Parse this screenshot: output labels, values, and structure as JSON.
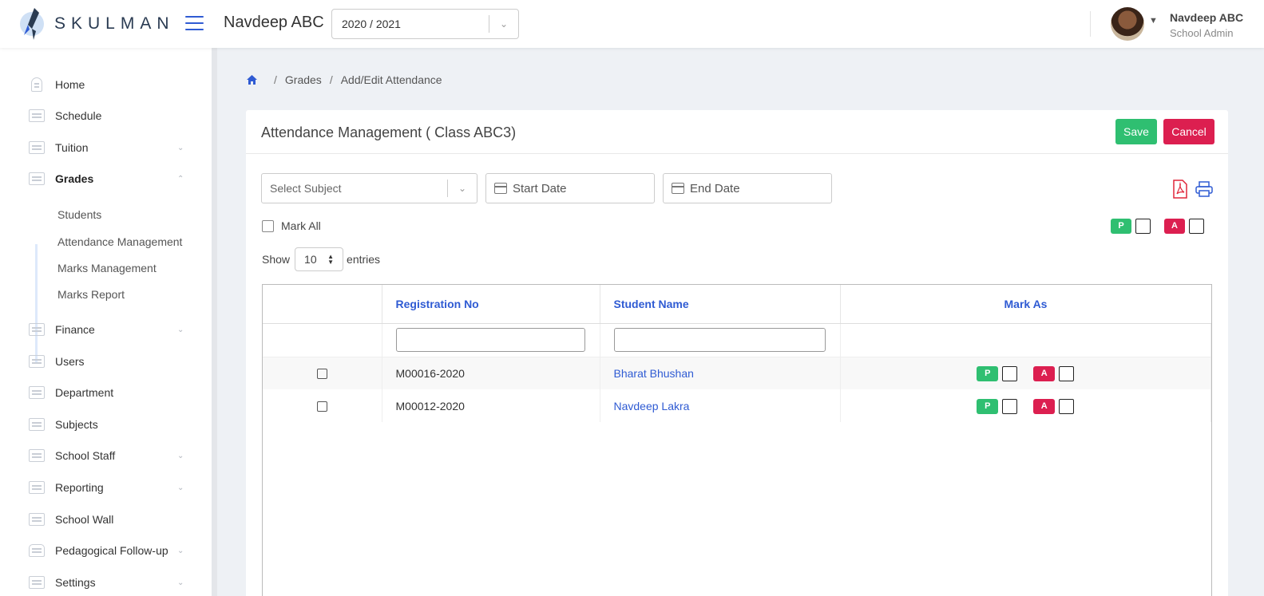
{
  "header": {
    "logo_text": "SKULMAN",
    "school_name": "Navdeep ABC",
    "year_select": {
      "value": "2020 / 2021"
    },
    "user": {
      "name": "Navdeep ABC",
      "role": "School Admin"
    }
  },
  "sidebar": {
    "items": [
      {
        "label": "Home"
      },
      {
        "label": "Schedule"
      },
      {
        "label": "Tuition"
      },
      {
        "label": "Grades"
      },
      {
        "label": "Finance"
      },
      {
        "label": "Users"
      },
      {
        "label": "Department"
      },
      {
        "label": "Subjects"
      },
      {
        "label": "School Staff"
      },
      {
        "label": "Reporting"
      },
      {
        "label": "School Wall"
      },
      {
        "label": "Pedagogical Follow-up"
      },
      {
        "label": "Settings"
      }
    ],
    "grades_sub": [
      {
        "label": "Students"
      },
      {
        "label": "Attendance Management"
      },
      {
        "label": "Marks Management"
      },
      {
        "label": "Marks Report"
      }
    ]
  },
  "breadcrumb": {
    "items": [
      "Grades",
      "Add/Edit Attendance"
    ]
  },
  "card": {
    "title": "Attendance Management ( Class ABC3)",
    "save_label": "Save",
    "cancel_label": "Cancel"
  },
  "filters": {
    "subject_placeholder": "Select Subject",
    "start_placeholder": "Start Date",
    "end_placeholder": "End Date"
  },
  "mark_all_label": "Mark All",
  "legend": {
    "present": "P",
    "absent": "A"
  },
  "length": {
    "show": "Show",
    "value": "10",
    "entries": "entries"
  },
  "table": {
    "columns": [
      "",
      "Registration No",
      "Student Name",
      "Mark As"
    ],
    "rows": [
      {
        "reg": "M00016-2020",
        "name": "Bharat Bhushan"
      },
      {
        "reg": "M00012-2020",
        "name": "Navdeep Lakra"
      }
    ]
  },
  "colors": {
    "accent": "#2f5bd3",
    "present": "#2fbf71",
    "absent": "#dc1f50"
  }
}
